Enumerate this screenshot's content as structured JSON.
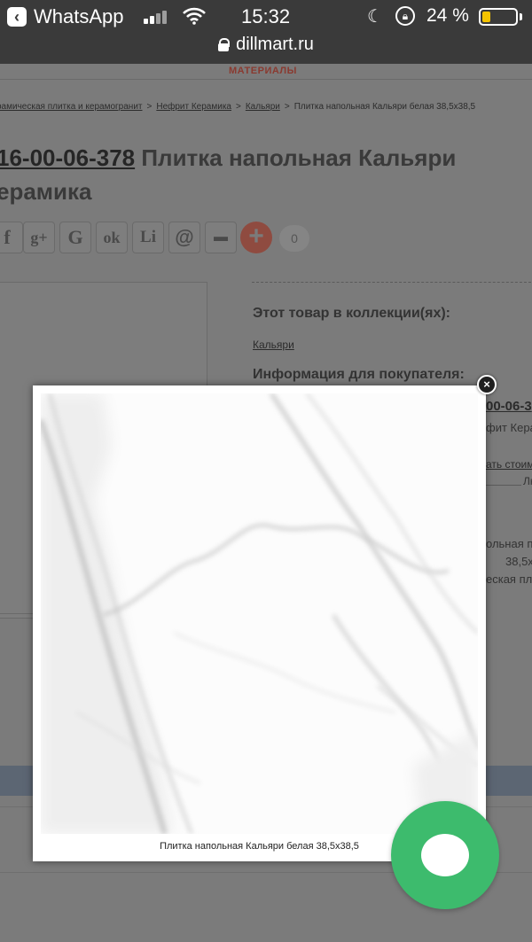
{
  "status_bar": {
    "back_app": "WhatsApp",
    "time": "15:32",
    "battery_percent": "24 %",
    "battery_level": 0.24,
    "icons": [
      "back-arrow-icon",
      "signal-icon",
      "wifi-icon",
      "moon-icon",
      "rotation-lock-icon",
      "battery-icon"
    ]
  },
  "url_bar": {
    "url": "dillmart.ru"
  },
  "page": {
    "menu_item": "МАТЕРИАЛЫ",
    "breadcrumb": [
      "рамическая плитка и керамогранит",
      "Нефрит Керамика",
      "Кальяри",
      "Плитка напольная Кальяри белая 38,5x38,5"
    ],
    "breadcrumb_sep": ">",
    "product_code": "16-00-06-378",
    "product_title_line1": "Плитка напольная Кальяри",
    "product_title_line2": "ерамика",
    "share_buttons": [
      "f",
      "g+",
      "G",
      "ok",
      "Li",
      "@",
      "print"
    ],
    "share_count": "0",
    "collection_heading": "Этот товар в коллекции(ях):",
    "collection_link": "Кальяри",
    "info_heading": "Информация для покупателя:",
    "side_code": "00-06-3",
    "side_brand": "фит Кера",
    "side_link": "ать стоим",
    "side_l": "Лк",
    "side_p1": "ольная пл",
    "side_p2": "38,5х",
    "side_p3": "еская пл"
  },
  "lightbox": {
    "caption": "Плитка напольная Кальяри белая 38,5x38,5",
    "close_label": "×"
  },
  "chat_widget": {
    "icon": "chat-bubble-icon"
  },
  "colors": {
    "status_bar_bg": "#3a3a3a",
    "battery_fill": "#f5c400",
    "chat_green": "#3dbb6d",
    "accent_red": "#c0392b"
  }
}
